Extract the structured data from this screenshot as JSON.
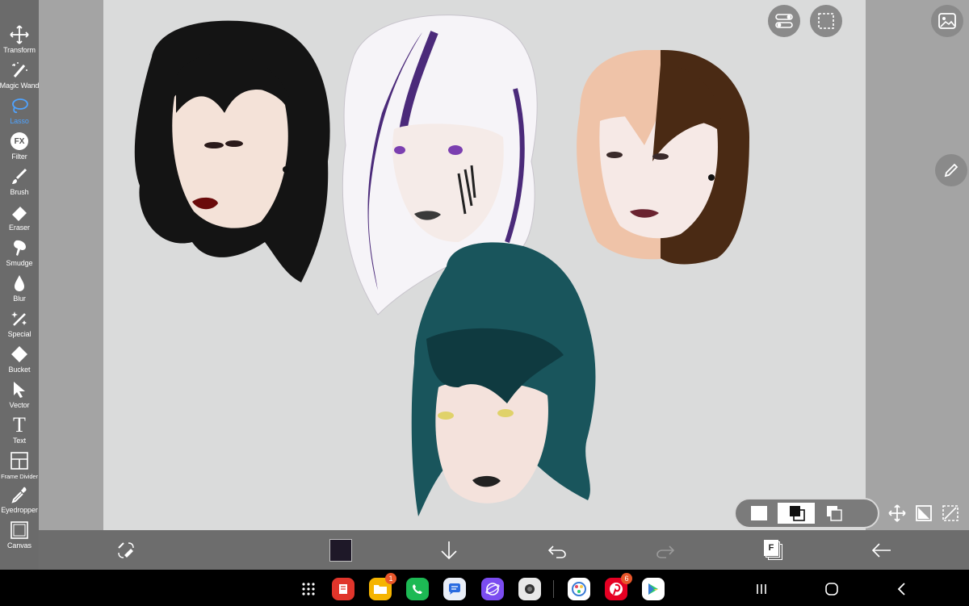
{
  "tools": [
    {
      "name": "Transform",
      "icon": "move-arrows-icon"
    },
    {
      "name": "Magic Wand",
      "icon": "magic-wand-icon"
    },
    {
      "name": "Lasso",
      "icon": "lasso-icon",
      "active": true
    },
    {
      "name": "Filter",
      "icon": "fx-icon"
    },
    {
      "name": "Brush",
      "icon": "brush-icon"
    },
    {
      "name": "Eraser",
      "icon": "eraser-icon"
    },
    {
      "name": "Smudge",
      "icon": "smudge-icon"
    },
    {
      "name": "Blur",
      "icon": "blur-drop-icon"
    },
    {
      "name": "Special",
      "icon": "sparkle-wand-icon"
    },
    {
      "name": "Bucket",
      "icon": "bucket-icon"
    },
    {
      "name": "Vector",
      "icon": "cursor-arrow-icon"
    },
    {
      "name": "Text",
      "icon": "text-t-icon"
    },
    {
      "name": "Frame Divider",
      "icon": "frame-divider-icon"
    },
    {
      "name": "Eyedropper",
      "icon": "eyedropper-icon"
    },
    {
      "name": "Canvas",
      "icon": "canvas-icon"
    }
  ],
  "filter_glyph": "FX",
  "text_glyph": "T",
  "layers_glyph": "F",
  "colors": {
    "active_tool": "#4fa3ff",
    "current_color": "#1e1828",
    "canvas_bg": "#dadbdb",
    "badge": "#e8562a"
  },
  "taskbar_apps": [
    {
      "name": "Samsung Notes",
      "icon": "notes-icon",
      "color": "#e0352b",
      "badge": ""
    },
    {
      "name": "My Files",
      "icon": "folder-icon",
      "color": "#f5b400",
      "badge": "1"
    },
    {
      "name": "Phone",
      "icon": "phone-icon",
      "color": "#1db954",
      "badge": ""
    },
    {
      "name": "Messages",
      "icon": "messages-icon",
      "color": "#e9eef8",
      "badge": ""
    },
    {
      "name": "Internet",
      "icon": "internet-icon",
      "color": "#7b4cf0",
      "badge": ""
    },
    {
      "name": "Camera",
      "icon": "camera-icon",
      "color": "#e8e8e8",
      "badge": ""
    },
    {
      "name": "ibisPaint",
      "icon": "ibispaint-icon",
      "color": "#ffffff",
      "badge": ""
    },
    {
      "name": "Pinterest",
      "icon": "pinterest-icon",
      "color": "#e60023",
      "badge": "6"
    },
    {
      "name": "Play Store",
      "icon": "play-store-icon",
      "color": "#ffffff",
      "badge": ""
    }
  ]
}
